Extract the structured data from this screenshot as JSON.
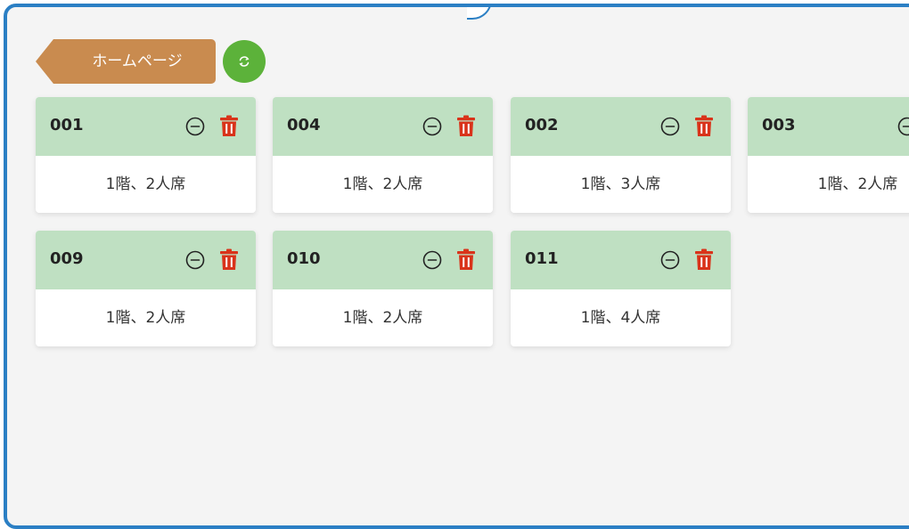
{
  "toolbar": {
    "home_label": "ホームページ"
  },
  "colors": {
    "frame_border": "#2b7fc4",
    "home_button": "#c98b4f",
    "refresh_button": "#5cb23a",
    "card_header": "#bfe0c2",
    "trash": "#d9331a"
  },
  "icons": {
    "refresh": "refresh-icon",
    "remove": "minus-circle-icon",
    "delete": "trash-icon"
  },
  "tables": [
    {
      "number": "001",
      "info": "1階、2人席"
    },
    {
      "number": "004",
      "info": "1階、2人席"
    },
    {
      "number": "002",
      "info": "1階、3人席"
    },
    {
      "number": "003",
      "info": "1階、2人席"
    },
    {
      "number": "009",
      "info": "1階、2人席"
    },
    {
      "number": "010",
      "info": "1階、2人席"
    },
    {
      "number": "011",
      "info": "1階、4人席"
    }
  ]
}
